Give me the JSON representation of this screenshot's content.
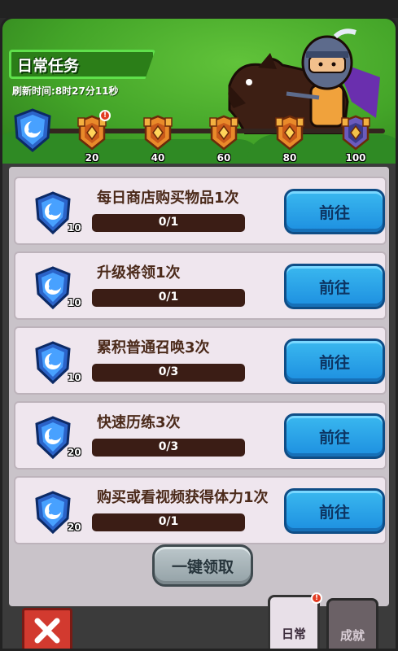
{
  "header": {
    "title": "日常任务",
    "refresh_label": "刷新时间:",
    "refresh_time": "8时27分11秒"
  },
  "progress": {
    "current_points": 0,
    "milestones": [
      {
        "points": "20",
        "has_alert": true
      },
      {
        "points": "40",
        "has_alert": false
      },
      {
        "points": "60",
        "has_alert": false
      },
      {
        "points": "80",
        "has_alert": false
      },
      {
        "points": "100",
        "has_alert": false
      }
    ]
  },
  "tasks": [
    {
      "title": "每日商店购买物品1次",
      "progress": "0/1",
      "reward": "10",
      "button": "前往"
    },
    {
      "title": "升级将领1次",
      "progress": "0/1",
      "reward": "10",
      "button": "前往"
    },
    {
      "title": "累积普通召唤3次",
      "progress": "0/3",
      "reward": "10",
      "button": "前往"
    },
    {
      "title": "快速历练3次",
      "progress": "0/3",
      "reward": "20",
      "button": "前往"
    },
    {
      "title": "购买或看视频获得体力1次",
      "progress": "0/1",
      "reward": "20",
      "button": "前往"
    }
  ],
  "claim_all": "一键领取",
  "tabs": {
    "daily": "日常",
    "achievement": "成就"
  },
  "colors": {
    "header_green": "#43a428",
    "go_button": "#2ea6ea",
    "alert_red": "#e23b22"
  }
}
